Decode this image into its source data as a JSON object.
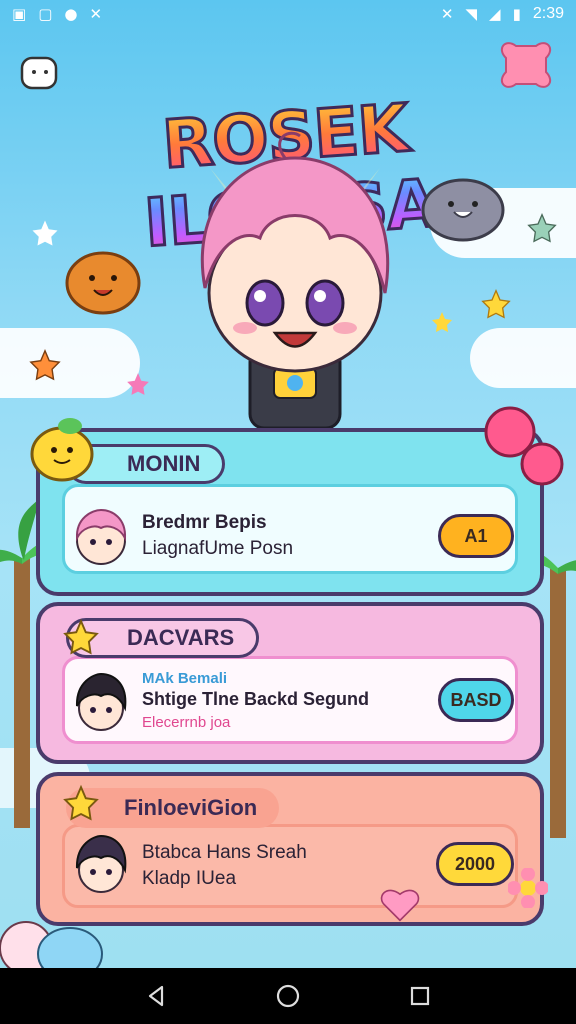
{
  "status_bar": {
    "time": "2:39",
    "left_icons": [
      "image-icon",
      "folder-icon",
      "location-icon",
      "tools-icon"
    ],
    "right_icons": [
      "mute-icon",
      "wifi-icon",
      "signal-icon",
      "battery-icon"
    ]
  },
  "title": {
    "part1": "ROSEK",
    "part2": "ILOQISA"
  },
  "cards": [
    {
      "tab_label": "MONIN",
      "line1": "Bredmr Bepis",
      "line2": "LiagnafUme Posn",
      "button_label": "A1",
      "colors": {
        "outer": "#7fe3ef",
        "inner_border": "#5ccfe0",
        "tab": "#9eeef5",
        "button": "#ffb21f"
      }
    },
    {
      "tab_label": "DACVARS",
      "line0": "MAk Bemali",
      "line1": "Shtige Tlne Backd Segund",
      "line2": "Elecerrnb joa",
      "button_label": "BASD",
      "colors": {
        "outer": "#f6b9e0",
        "inner_border": "#ef8fcf",
        "tab": "#f8c7e6",
        "button": "#4fd6ea"
      }
    },
    {
      "tab_label": "FinloeviGion",
      "line1": "Btabca Hans Sreah",
      "line2": "Kladp IUea",
      "button_label": "2000",
      "colors": {
        "outer": "#fbb3a2",
        "inner_border": "#f59a87",
        "tab": "#f9a391",
        "button": "#ffd93a"
      }
    }
  ],
  "nav": [
    "back-icon",
    "home-icon",
    "recents-icon"
  ]
}
